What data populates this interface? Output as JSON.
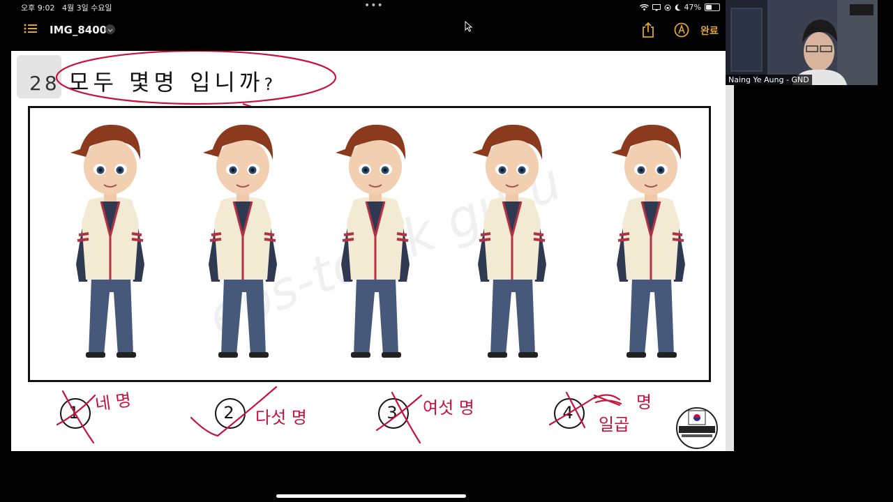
{
  "status": {
    "time": "오후 9:02",
    "date": "4월 3일 수요일",
    "dots": "•••",
    "battery": "47%",
    "battery_level": 0.47
  },
  "toolbar": {
    "title": "IMG_8400",
    "done": "완료"
  },
  "question": {
    "number": "28",
    "text": "모두 몇명 입니까",
    "mark": "?"
  },
  "boys_count": 5,
  "answers": [
    {
      "num": "1",
      "text": "네 명"
    },
    {
      "num": "2",
      "text": "다섯 명"
    },
    {
      "num": "3",
      "text": "여섯 명"
    },
    {
      "num": "4",
      "text": "일곱 명"
    }
  ],
  "handwriting": {
    "a1": "네 명",
    "a2": "다섯 명",
    "a3": "여섯 명",
    "a4_top": "명",
    "a4_bottom": "일곱"
  },
  "zoom": {
    "participant_name": "Naing Ye Aung - GND"
  },
  "colors": {
    "accent": "#e0a72e",
    "ink": "#c8103c"
  }
}
